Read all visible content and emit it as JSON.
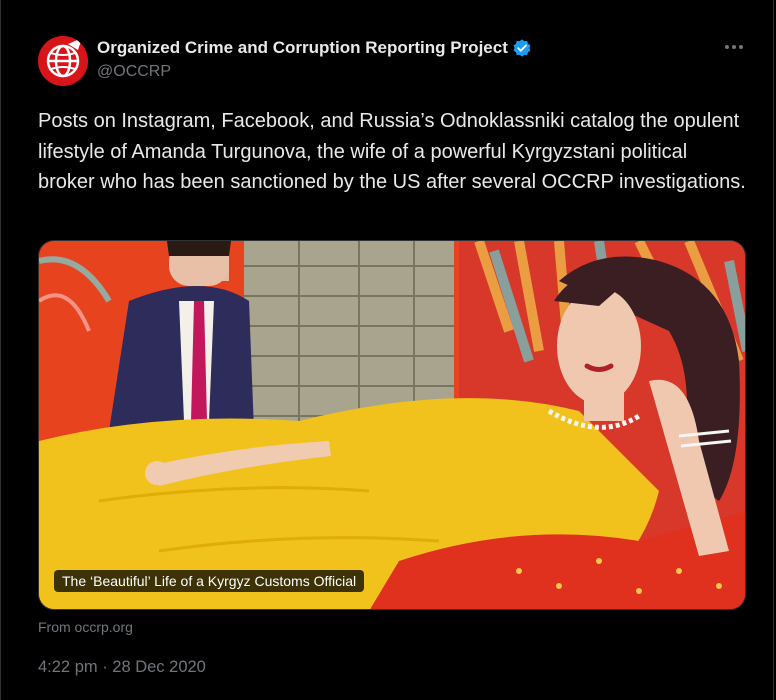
{
  "account": {
    "display_name": "Organized Crime and Corruption Reporting Project",
    "handle": "@OCCRP",
    "verified_icon": "verified-badge-icon",
    "avatar_icon": "globe-logo-icon"
  },
  "tweet": {
    "text": "Posts on Instagram, Facebook, and Russia’s Odnoklassniki catalog the opulent lifestyle of Amanda Turgunova, the wife of a powerful Kyrgyzstani political broker who has been sanctioned by the US after several OCCRP investigations.",
    "timestamp": "4:22 pm · 28 Dec 2020"
  },
  "card": {
    "title": "The ‘Beautiful’ Life of a Kyrgyz Customs Official",
    "source": "From occrp.org"
  },
  "colors": {
    "background": "#000000",
    "text": "#e7e9ea",
    "muted": "#71767b",
    "verified": "#1d9bf0",
    "brand_red": "#d7141a"
  }
}
